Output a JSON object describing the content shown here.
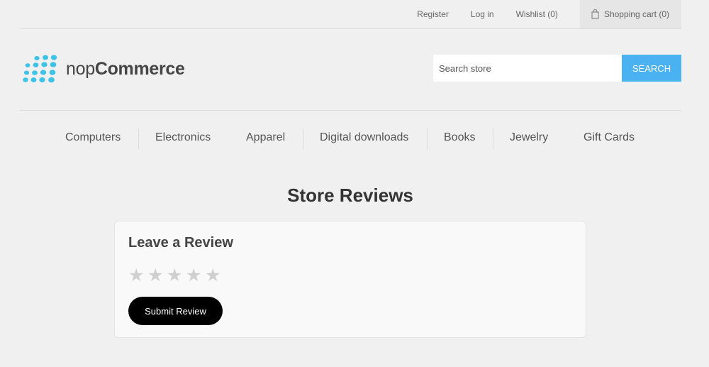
{
  "header_links": {
    "register": "Register",
    "login": "Log in",
    "wishlist": "Wishlist (0)",
    "cart": "Shopping cart (0)"
  },
  "logo": {
    "text_light": "nop",
    "text_bold": "Commerce",
    "color": "#3ec2e6"
  },
  "search": {
    "placeholder": "Search store",
    "button_label": "SEARCH",
    "accent": "#4ab2f1"
  },
  "nav": {
    "items": [
      "Computers",
      "Electronics",
      "Apparel",
      "Digital downloads",
      "Books",
      "Jewelry",
      "Gift Cards"
    ]
  },
  "page": {
    "title": "Store Reviews"
  },
  "review_form": {
    "heading": "Leave a Review",
    "rating": {
      "value": 0,
      "max": 5,
      "star_glyph": "★"
    },
    "submit_label": "Submit Review"
  }
}
